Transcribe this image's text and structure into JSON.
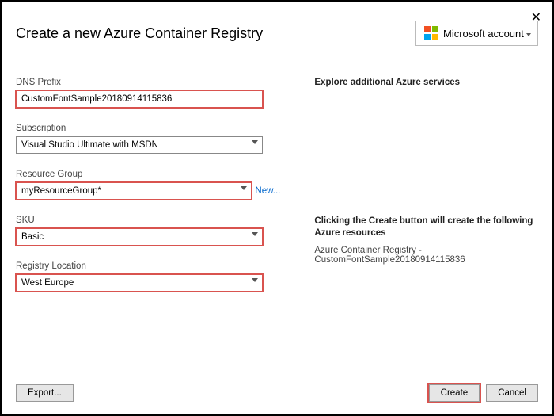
{
  "window": {
    "title": "Create a new Azure Container Registry"
  },
  "account": {
    "label": "Microsoft account"
  },
  "fields": {
    "dns": {
      "label": "DNS Prefix",
      "value": "CustomFontSample20180914115836"
    },
    "sub": {
      "label": "Subscription",
      "value": "Visual Studio Ultimate with MSDN"
    },
    "rg": {
      "label": "Resource Group",
      "value": "myResourceGroup*",
      "newLink": "New..."
    },
    "sku": {
      "label": "SKU",
      "value": "Basic"
    },
    "loc": {
      "label": "Registry Location",
      "value": "West Europe"
    }
  },
  "right": {
    "heading": "Explore additional Azure services",
    "midHeading": "Clicking the Create button will create the following Azure resources",
    "sub": "Azure Container Registry - CustomFontSample20180914115836"
  },
  "buttons": {
    "export": "Export...",
    "create": "Create",
    "cancel": "Cancel"
  }
}
